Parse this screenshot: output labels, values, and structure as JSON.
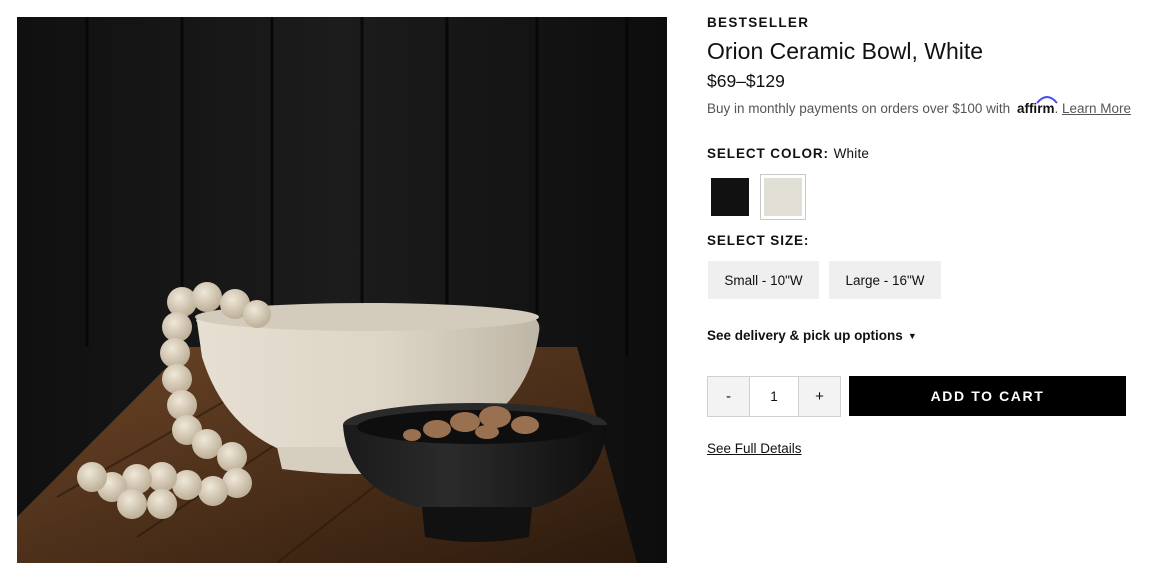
{
  "product": {
    "badge": "BESTSELLER",
    "title": "Orion Ceramic Bowl, White",
    "price": "$69–$129",
    "image_alt": "Orion Ceramic Bowl in white and black on a wooden table with wooden bead garland"
  },
  "financing": {
    "text": "Buy in monthly payments on orders over $100 with",
    "brand": "affirm",
    "link": "Learn More"
  },
  "color": {
    "label": "SELECT COLOR:",
    "selected": "White",
    "options": [
      {
        "name": "Black",
        "hex": "#111111"
      },
      {
        "name": "White",
        "hex": "#e1dfd6"
      }
    ]
  },
  "size": {
    "label": "SELECT SIZE:",
    "options": [
      "Small - 10\"W",
      "Large - 16\"W"
    ]
  },
  "delivery": {
    "label": "See delivery & pick up options"
  },
  "cart": {
    "decrement": "-",
    "quantity": "1",
    "increment": "+",
    "add_label": "ADD TO CART"
  },
  "details_link": "See Full Details",
  "colors": {
    "accent": "#000000",
    "affirm_arc": "#4a4af4"
  }
}
